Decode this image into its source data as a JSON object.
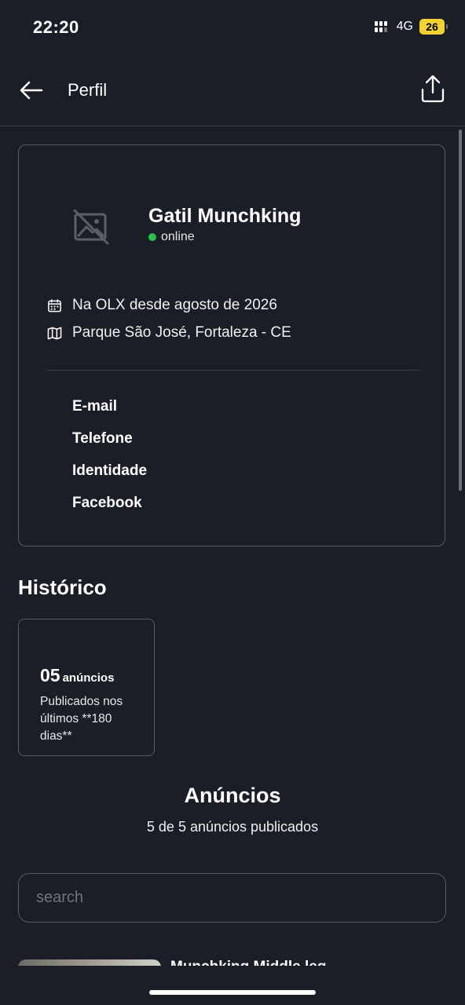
{
  "status_bar": {
    "time": "22:20",
    "network": "4G",
    "battery": "26"
  },
  "header": {
    "title": "Perfil",
    "back_icon": "arrow-left-icon",
    "share_icon": "share-icon"
  },
  "profile": {
    "name": "Gatil Munchking",
    "status": "online",
    "status_color": "#27c04b",
    "avatar_icon": "image-placeholder-icon",
    "member_since": "Na OLX desde agosto de 2026",
    "location": "Parque São José, Fortaleza - CE",
    "verifications": [
      "E-mail",
      "Telefone",
      "Identidade",
      "Facebook"
    ]
  },
  "history": {
    "title": "Histórico",
    "count": "05",
    "count_unit": "anúncios",
    "description": "Publicados nos últimos **180 dias**"
  },
  "ads": {
    "title": "Anúncios",
    "subtitle": "5 de 5 anúncios publicados",
    "search_placeholder": "search",
    "first_item_title": "Munchking Middle leg"
  }
}
